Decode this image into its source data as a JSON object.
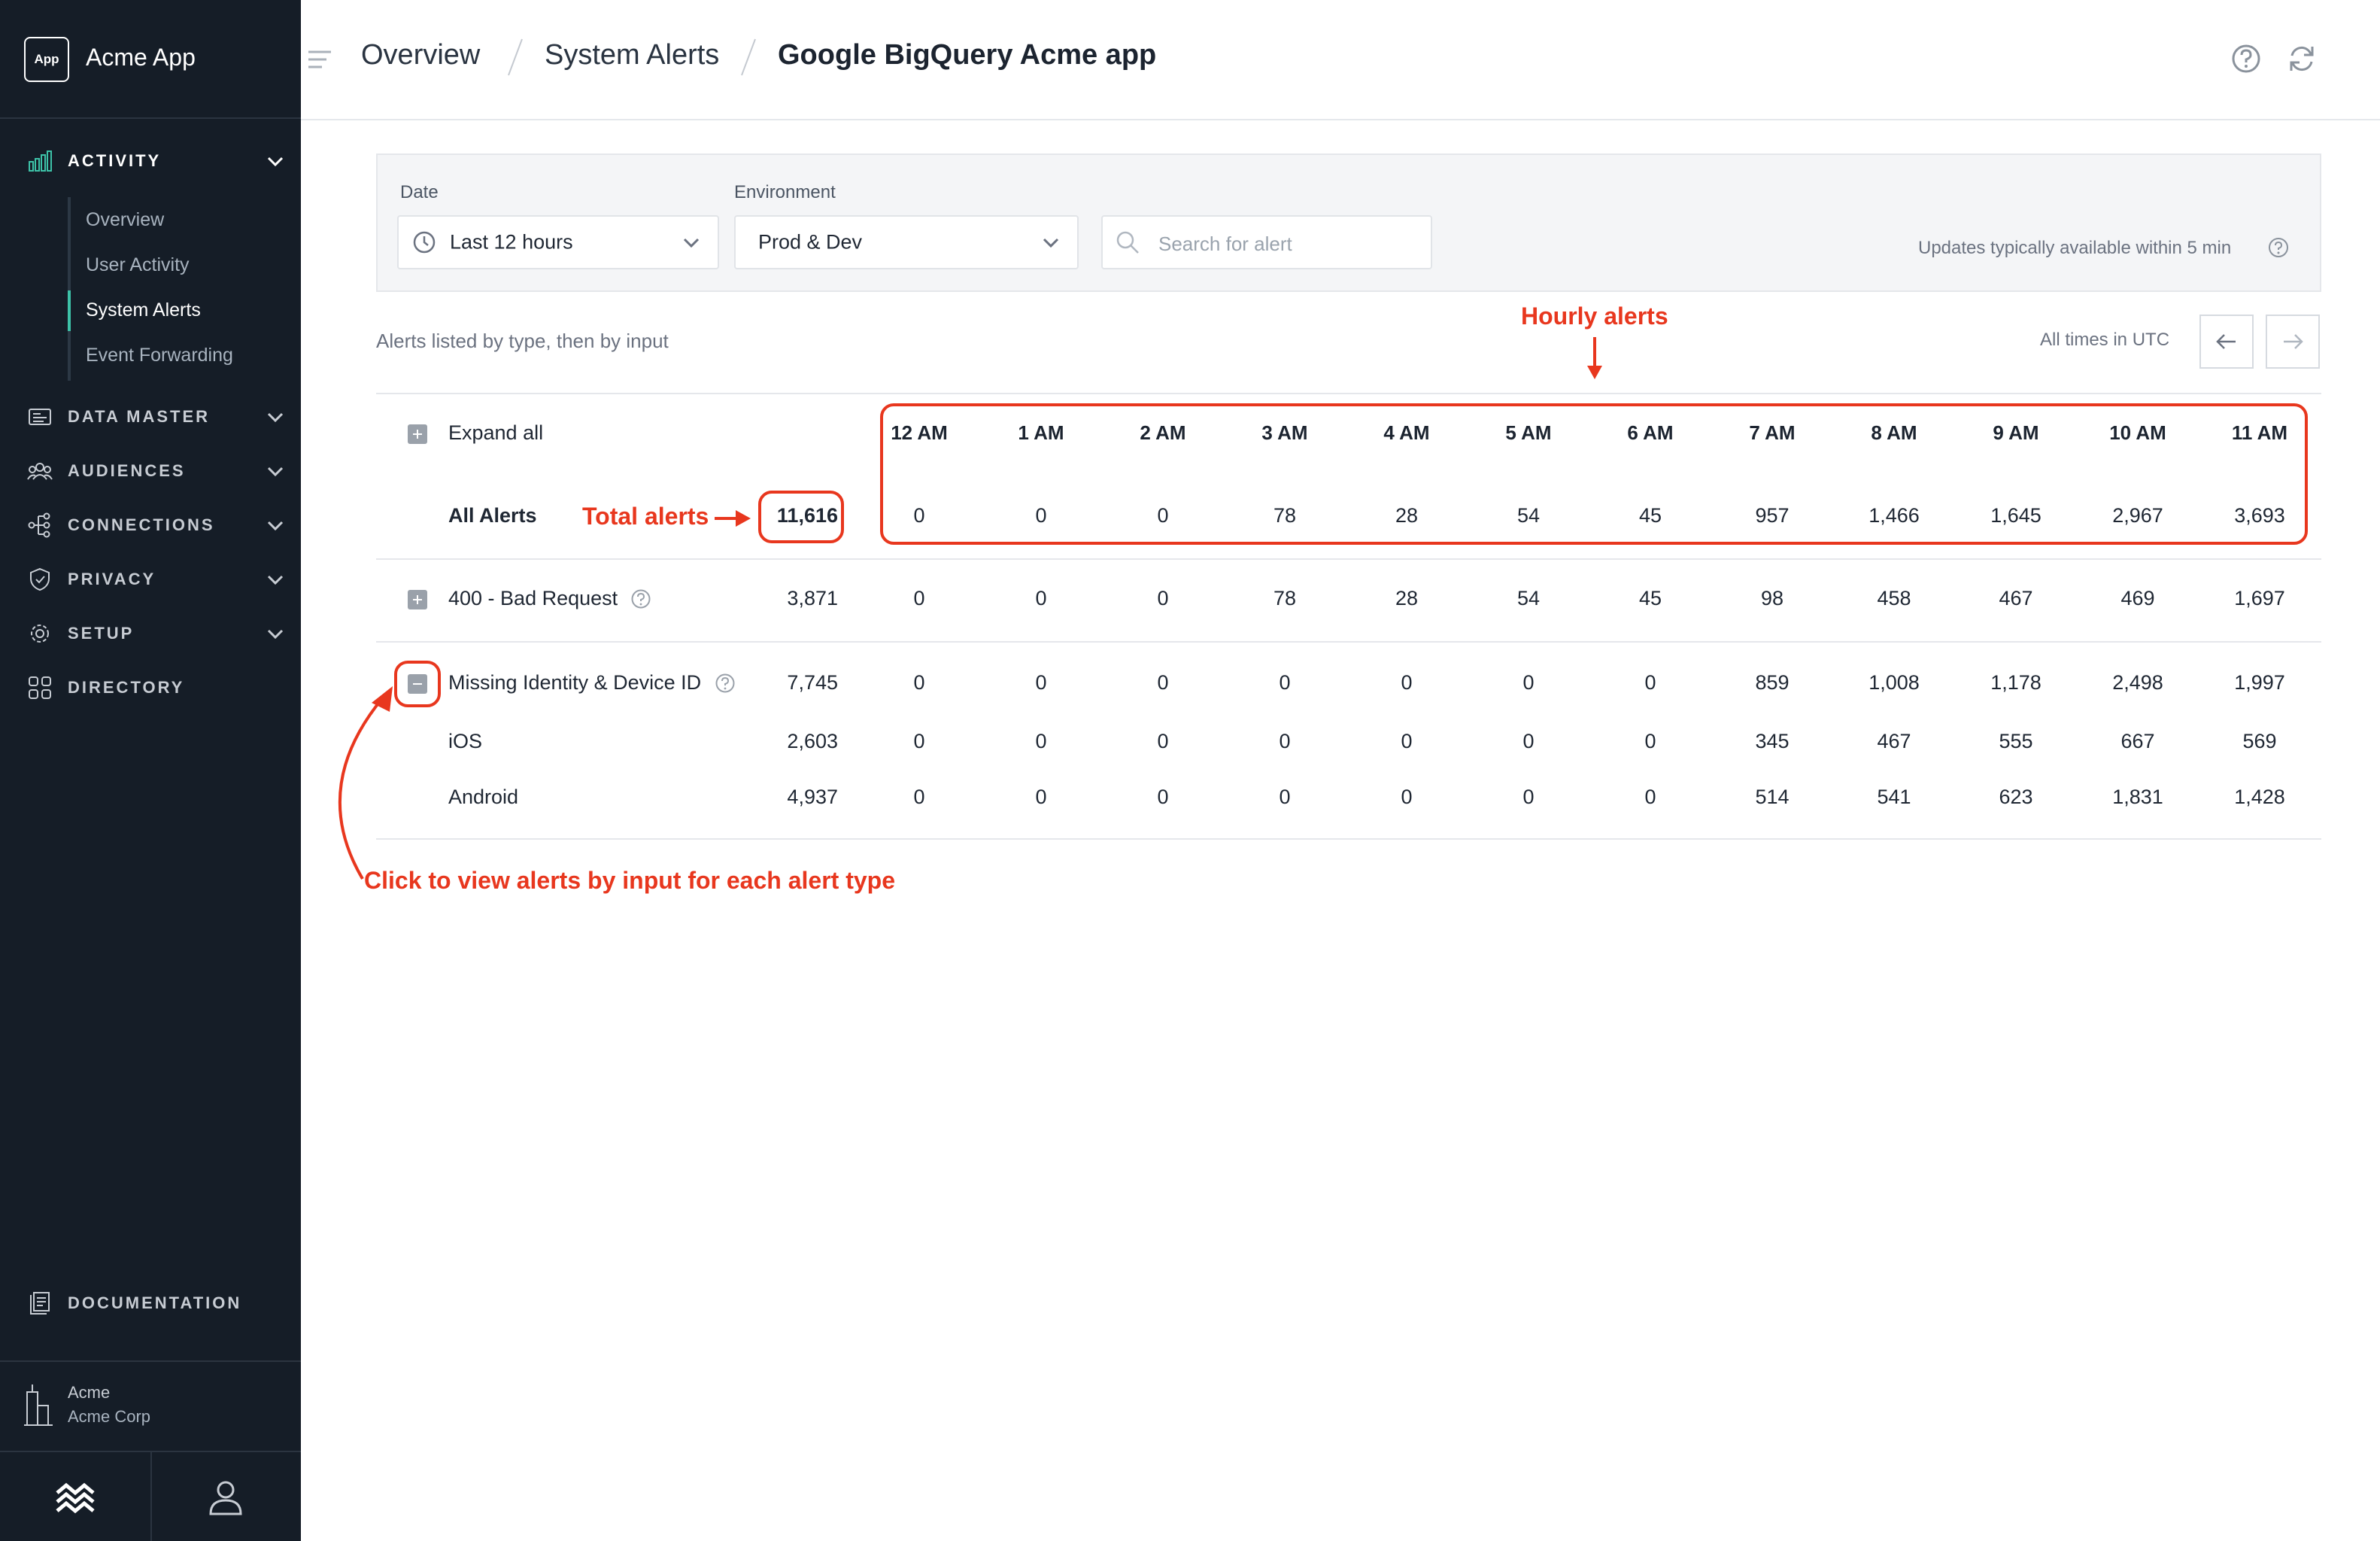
{
  "app": {
    "badge": "App",
    "name": "Acme App"
  },
  "sidebar": {
    "sections": [
      {
        "label": "ACTIVITY",
        "icon": "bar-chart-icon",
        "expanded": true
      },
      {
        "label": "DATA MASTER",
        "icon": "data-master-icon"
      },
      {
        "label": "AUDIENCES",
        "icon": "audiences-icon"
      },
      {
        "label": "CONNECTIONS",
        "icon": "connections-icon"
      },
      {
        "label": "PRIVACY",
        "icon": "shield-icon"
      },
      {
        "label": "SETUP",
        "icon": "gear-icon"
      },
      {
        "label": "DIRECTORY",
        "icon": "grid-icon"
      }
    ],
    "activity_items": [
      "Overview",
      "User Activity",
      "System Alerts",
      "Event Forwarding"
    ],
    "active_item": "System Alerts",
    "documentation": "DOCUMENTATION",
    "org": {
      "name": "Acme",
      "sub": "Acme Corp"
    },
    "accent": "#3dc2a8"
  },
  "header": {
    "crumbs": [
      "Overview",
      "System Alerts",
      "Google BigQuery Acme app"
    ],
    "icons": [
      "help-icon",
      "refresh-icon"
    ]
  },
  "filters": {
    "date_label": "Date",
    "date_value": "Last 12 hours",
    "env_label": "Environment",
    "env_value": "Prod & Dev",
    "search_placeholder": "Search for alert",
    "updates_note": "Updates typically available within 5 min"
  },
  "table": {
    "subtitle": "Alerts listed by type, then by input",
    "timezone_note": "All times in UTC",
    "expand_all": "Expand all",
    "hours": [
      "12 AM",
      "1 AM",
      "2 AM",
      "3 AM",
      "4 AM",
      "5 AM",
      "6 AM",
      "7 AM",
      "8 AM",
      "9 AM",
      "10 AM",
      "11 AM"
    ],
    "rows": [
      {
        "label": "All Alerts",
        "total": "11,616",
        "values": [
          "0",
          "0",
          "0",
          "78",
          "28",
          "54",
          "45",
          "957",
          "1,466",
          "1,645",
          "2,967",
          "3,693"
        ]
      },
      {
        "label": "400 - Bad Request",
        "total": "3,871",
        "values": [
          "0",
          "0",
          "0",
          "78",
          "28",
          "54",
          "45",
          "98",
          "458",
          "467",
          "469",
          "1,697"
        ]
      },
      {
        "label": "Missing Identity & Device ID",
        "total": "7,745",
        "values": [
          "0",
          "0",
          "0",
          "0",
          "0",
          "0",
          "0",
          "859",
          "1,008",
          "1,178",
          "2,498",
          "1,997"
        ]
      },
      {
        "label": "iOS",
        "total": "2,603",
        "values": [
          "0",
          "0",
          "0",
          "0",
          "0",
          "0",
          "0",
          "345",
          "467",
          "555",
          "667",
          "569"
        ]
      },
      {
        "label": "Android",
        "total": "4,937",
        "values": [
          "0",
          "0",
          "0",
          "0",
          "0",
          "0",
          "0",
          "514",
          "541",
          "623",
          "1,831",
          "1,428"
        ]
      }
    ]
  },
  "annotations": {
    "hourly": "Hourly alerts",
    "total": "Total alerts",
    "click": "Click to view alerts by input for each alert type",
    "color": "#e8371e"
  }
}
